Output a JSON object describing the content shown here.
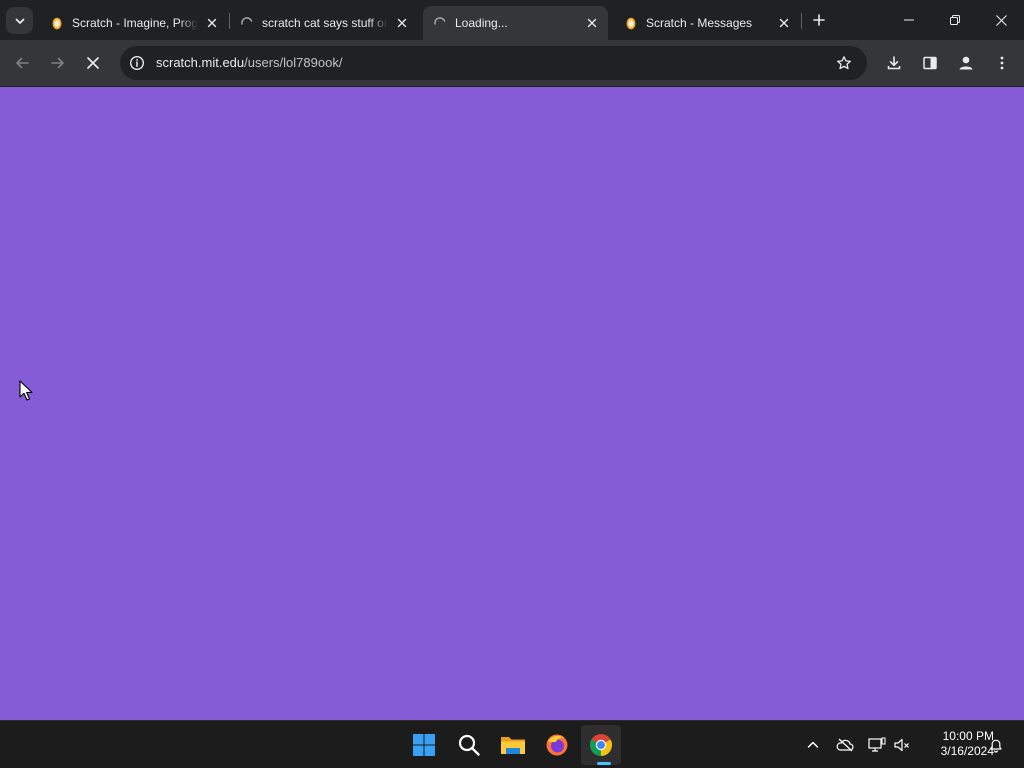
{
  "browser": {
    "tabs": [
      {
        "title": "Scratch - Imagine, Program, Share",
        "icon": "scratch-favicon",
        "active": false
      },
      {
        "title": "scratch cat says stuff on Scratch",
        "icon": "loading-spinner",
        "active": false
      },
      {
        "title": "Loading...",
        "icon": "loading-spinner",
        "active": true
      },
      {
        "title": "Scratch - Messages",
        "icon": "scratch-favicon",
        "active": false
      }
    ],
    "address": {
      "host": "scratch.mit.edu",
      "path": "/users/lol789ook/"
    }
  },
  "page": {
    "background_color": "#855cd6"
  },
  "taskbar": {
    "apps": [
      "start",
      "search",
      "file-explorer",
      "firefox",
      "chrome"
    ],
    "clock": {
      "time": "10:00 PM",
      "date": "3/16/2024"
    }
  }
}
